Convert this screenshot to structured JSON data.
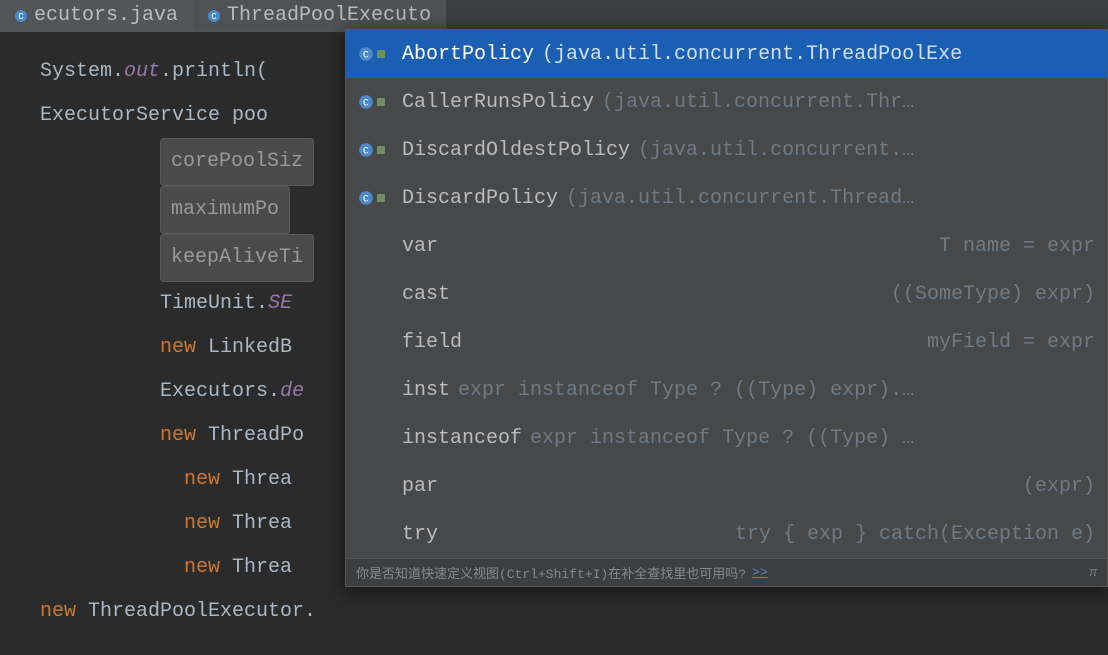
{
  "tabs": [
    {
      "label": "ecutors.java"
    },
    {
      "label": "ThreadPoolExecuto"
    }
  ],
  "code": {
    "line1_a": "System.",
    "line1_b": "out",
    "line1_c": ".println(",
    "line2": "ExecutorService poo",
    "hint1": "corePoolSiz",
    "hint2": "maximumPo",
    "hint3": "keepAliveTi",
    "line6_a": "TimeUnit.",
    "line6_b": "SE",
    "line7_a": "new",
    "line7_b": " LinkedB",
    "line8_a": "Executors.",
    "line8_b": "de",
    "line9_a": "new",
    "line9_b": " ThreadPo",
    "line10_a": "new",
    "line10_b": " Threa",
    "line11_a": "new",
    "line11_b": " Threa",
    "line12_a": "new",
    "line12_b": " Threa",
    "line13_a": "new",
    "line13_b": " ThreadPoolExecutor."
  },
  "popup": {
    "items": [
      {
        "name": "AbortPolicy",
        "tail": " (java.util.concurrent.ThreadPoolExe",
        "hint": "",
        "hasIcon": true
      },
      {
        "name": "CallerRunsPolicy",
        "tail": " (java.util.concurrent.Thr…",
        "hint": "",
        "hasIcon": true
      },
      {
        "name": "DiscardOldestPolicy",
        "tail": " (java.util.concurrent.…",
        "hint": "",
        "hasIcon": true
      },
      {
        "name": "DiscardPolicy",
        "tail": " (java.util.concurrent.Thread…",
        "hint": "",
        "hasIcon": true
      },
      {
        "name": "var",
        "tail": "",
        "hint": "T name = expr",
        "hasIcon": false
      },
      {
        "name": "cast",
        "tail": "",
        "hint": "((SomeType) expr)",
        "hasIcon": false
      },
      {
        "name": "field",
        "tail": "",
        "hint": "myField = expr",
        "hasIcon": false
      },
      {
        "name": "inst",
        "tail": " expr instanceof Type ? ((Type) expr).…",
        "hint": "",
        "hasIcon": false
      },
      {
        "name": "instanceof",
        "tail": " expr instanceof Type ? ((Type) …",
        "hint": "",
        "hasIcon": false
      },
      {
        "name": "par",
        "tail": "",
        "hint": "(expr)",
        "hasIcon": false
      },
      {
        "name": "try",
        "tail": "",
        "hint": "try { exp } catch(Exception e)",
        "hasIcon": false
      }
    ],
    "footer_text": "你是否知道快速定义视图(Ctrl+Shift+I)在补全查找里也可用吗?",
    "footer_link": ">>",
    "pi": "π"
  }
}
